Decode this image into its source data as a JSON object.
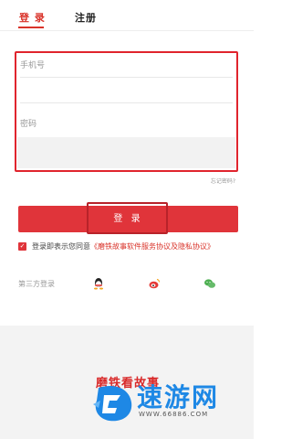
{
  "tabs": [
    {
      "label": "登 录",
      "active": true
    },
    {
      "label": "注册",
      "active": false
    }
  ],
  "form": {
    "phone_placeholder": "手机号",
    "password_placeholder": "密码",
    "forgot_label": "忘记密码?"
  },
  "login_button": {
    "label": "登 录"
  },
  "agreement": {
    "checked": true,
    "prefix": "登录即表示您同意",
    "link": "《磨铁故事软件服务协议及隐私协议》"
  },
  "third_party": {
    "label": "第三方登录",
    "icons": [
      "qq-icon",
      "weibo-icon",
      "wechat-icon"
    ]
  },
  "branding": {
    "app_name": "磨铁看故事",
    "watermark_title": "速游网",
    "watermark_url": "WWW.66886.COM"
  },
  "colors": {
    "accent": "#e0343a",
    "watermark_blue": "#1e88e5"
  }
}
